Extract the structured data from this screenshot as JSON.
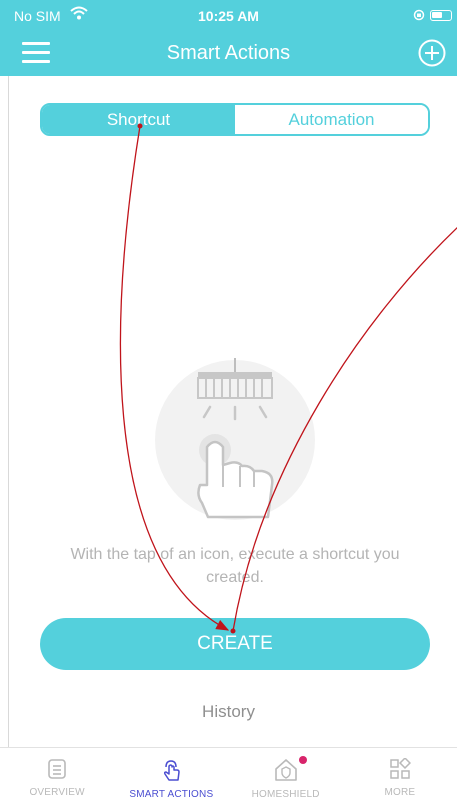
{
  "status_bar": {
    "carrier": "No SIM",
    "time": "10:25 AM",
    "icons": [
      "wifi-icon",
      "orientation-lock-icon",
      "battery-icon"
    ]
  },
  "header": {
    "title": "Smart Actions",
    "left_icon": "hamburger-menu-icon",
    "right_icon": "add-circle-icon"
  },
  "segmented": {
    "active": "Shortcut",
    "items": [
      "Shortcut",
      "Automation"
    ]
  },
  "empty_state": {
    "icon": "tap-shortcut-illustration",
    "text": "With the tap of an icon, execute a shortcut you created."
  },
  "create_button": "CREATE",
  "history_link": "History",
  "tab_bar": {
    "active": "SMART ACTIONS",
    "items": [
      {
        "label": "OVERVIEW",
        "icon": "document-icon"
      },
      {
        "label": "SMART ACTIONS",
        "icon": "tap-hand-icon"
      },
      {
        "label": "HOMESHIELD",
        "icon": "home-shield-icon",
        "badge": true
      },
      {
        "label": "MORE",
        "icon": "grid-icon"
      }
    ]
  },
  "colors": {
    "accent": "#54d0dc",
    "active_tab": "#4b4ed1",
    "badge": "#d8246b",
    "muted_text": "#b4b4b4",
    "annotation_arrow": "#c0141b"
  }
}
